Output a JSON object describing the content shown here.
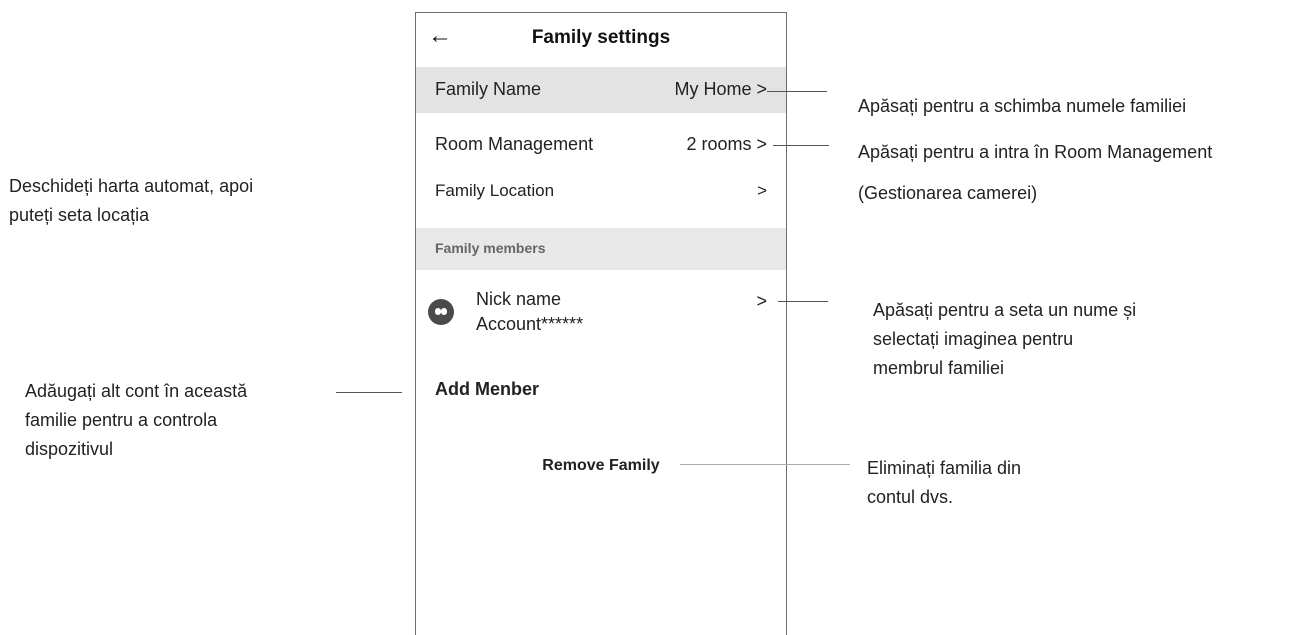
{
  "screen": {
    "back_icon": "arrow-left-icon",
    "title": "Family settings",
    "family_name": {
      "label": "Family Name",
      "value": "My Home >"
    },
    "room_management": {
      "label": "Room Management",
      "value": "2 rooms >"
    },
    "family_location": {
      "label": "Family Location",
      "value": ">"
    },
    "members_section": "Family members",
    "member": {
      "nick": "Nick name",
      "account": "Account******",
      "arrow": ">",
      "avatar_icon": "avatar-icon"
    },
    "add_member": "Add Menber",
    "remove_family": "Remove Family"
  },
  "annotations": {
    "family_name_note": "Apăsați pentru a schimba numele familiei",
    "room_note_line1": "Apăsați pentru a intra în Room Management",
    "room_note_line2": "(Gestionarea camerei)",
    "location_note_line1": "Deschideți harta automat, apoi",
    "location_note_line2": "puteți seta locația",
    "member_note_line1": "Apăsați pentru a seta un nume și",
    "member_note_line2": "selectați imaginea pentru",
    "member_note_line3": "membrul familiei",
    "add_note_line1": "Adăugați alt cont în această",
    "add_note_line2": "familie pentru a controla",
    "add_note_line3": "dispozitivul",
    "remove_note_line1": "Eliminați familia din",
    "remove_note_line2": "contul dvs."
  },
  "colors": {
    "highlight_row": "#e3e3e3",
    "section_header": "#e8e8e8",
    "frame_border": "#6e6e6e"
  }
}
